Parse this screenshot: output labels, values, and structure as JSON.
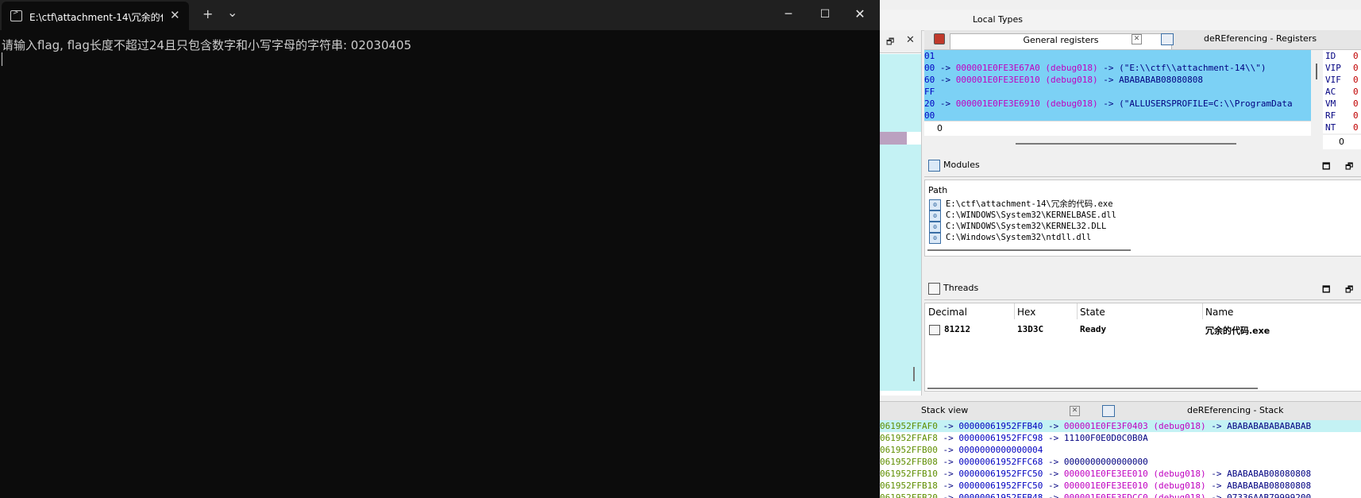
{
  "terminal": {
    "tab_title": "E:\\ctf\\attachment-14\\冗余的代",
    "new_tab_symbol": "+",
    "dropdown_symbol": "⌄",
    "prompt_line": "请输入flag, flag长度不超过24且只包含数字和小写字母的字符串: 02030405"
  },
  "ida": {
    "top_tab": "Local Types",
    "registers_panel": {
      "tab_general": "General registers",
      "tab_deref": "deREferencing - Registers",
      "lines": [
        {
          "addr": "01",
          "rest": ""
        },
        {
          "addr": "00",
          "arrow": " -> ",
          "ptr": "000001E0FE3E67A0",
          "seg": "(debug018)",
          "tail": " -> (\"E:\\\\ctf\\\\attachment-14\\\\\")"
        },
        {
          "addr": "60",
          "arrow": " -> ",
          "ptr": "000001E0FE3EE010",
          "seg": "(debug018)",
          "tail": " -> ABABABAB08080808"
        },
        {
          "addr": "FF",
          "rest": ""
        },
        {
          "addr": "20",
          "arrow": " -> ",
          "ptr": "000001E0FE3E6910",
          "seg": "(debug018)",
          "tail": " -> (\"ALLUSERSPROFILE=C:\\\\ProgramData"
        },
        {
          "addr": "00",
          "rest": ""
        }
      ],
      "counter": "0",
      "flags": [
        {
          "name": "ID",
          "val": "0"
        },
        {
          "name": "VIP",
          "val": "0"
        },
        {
          "name": "VIF",
          "val": "0"
        },
        {
          "name": "AC",
          "val": "0"
        },
        {
          "name": "VM",
          "val": "0"
        },
        {
          "name": "RF",
          "val": "0"
        },
        {
          "name": "NT",
          "val": "0"
        }
      ],
      "flags_counter": "0"
    },
    "modules": {
      "title": "Modules",
      "col_path": "Path",
      "rows": [
        "E:\\ctf\\attachment-14\\冗余的代码.exe",
        "C:\\WINDOWS\\System32\\KERNELBASE.dll",
        "C:\\WINDOWS\\System32\\KERNEL32.DLL",
        "C:\\Windows\\System32\\ntdll.dll"
      ]
    },
    "threads": {
      "title": "Threads",
      "columns": [
        "Decimal",
        "Hex",
        "State",
        "Name"
      ],
      "row": {
        "decimal": "81212",
        "hex": "13D3C",
        "state": "Ready",
        "name": "冗余的代码.exe"
      }
    },
    "stack_panel": {
      "tab_stack": "Stack view",
      "tab_deref": "deREferencing - Stack",
      "lines": [
        {
          "a": "061952FFAF0",
          "b": "00000061952FFB40",
          "c": "000001E0FE3F0403",
          "seg": "(debug018)",
          "t": "ABABABABABABABAB"
        },
        {
          "a": "061952FFAF8",
          "b": "00000061952FFC98",
          "c": "",
          "seg": "",
          "t": "11100F0E0D0C0B0A"
        },
        {
          "a": "061952FFB00",
          "b": "0000000000000004",
          "c": "",
          "seg": "",
          "t": ""
        },
        {
          "a": "061952FFB08",
          "b": "00000061952FFC68",
          "c": "",
          "seg": "",
          "t": "0000000000000000"
        },
        {
          "a": "061952FFB10",
          "b": "00000061952FFC50",
          "c": "000001E0FE3EE010",
          "seg": "(debug018)",
          "t": "ABABABAB08080808"
        },
        {
          "a": "061952FFB18",
          "b": "00000061952FFC50",
          "c": "000001E0FE3EE010",
          "seg": "(debug018)",
          "t": "ABABABAB08080808"
        },
        {
          "a": "061952FFB20",
          "b": "00000061952FFB48",
          "c": "000001E0FE3EDCC0",
          "seg": "(debug018)",
          "t": "07336AAB79999200"
        }
      ]
    }
  },
  "colors": {
    "terminal_bg": "#0c0c0c",
    "terminal_text": "#cccccc",
    "highlight_blue": "#7cd1f5",
    "highlight_cyan": "#c4f2f4"
  }
}
